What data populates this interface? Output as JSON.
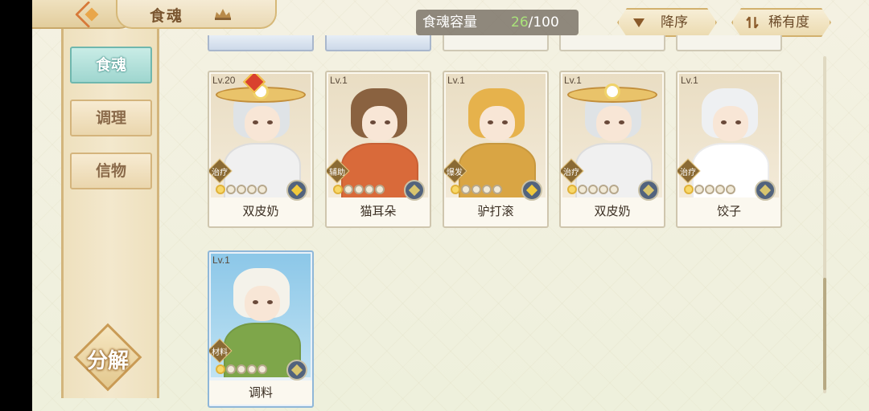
{
  "header": {
    "title": "食魂",
    "capacity_label": "食魂容量",
    "capacity_current": "26",
    "capacity_max": "/100",
    "sort_desc_label": "降序",
    "sort_rarity_label": "稀有度"
  },
  "sidebar": {
    "tabs": [
      {
        "label": "食魂",
        "active": true
      },
      {
        "label": "调理",
        "active": false
      },
      {
        "label": "信物",
        "active": false
      }
    ],
    "decompose_label": "分解"
  },
  "cards": [
    {
      "level": "Lv.20",
      "name": "双皮奶",
      "role": "治疗",
      "stars_on": 1,
      "stars_total": 5,
      "element": "gold-icon",
      "hair": "#dfe3e6",
      "body": "#f0f0f0",
      "hat": true,
      "badge": true,
      "style": "normal"
    },
    {
      "level": "Lv.1",
      "name": "猫耳朵",
      "role": "辅助",
      "stars_on": 1,
      "stars_total": 5,
      "element": "blue-icon",
      "hair": "#8a6240",
      "body": "#d96a3a",
      "hat": false,
      "badge": false,
      "style": "normal"
    },
    {
      "level": "Lv.1",
      "name": "驴打滚",
      "role": "爆发",
      "stars_on": 1,
      "stars_total": 5,
      "element": "gold-icon",
      "hair": "#e6b24c",
      "body": "#d9a544",
      "hat": false,
      "badge": false,
      "style": "normal"
    },
    {
      "level": "Lv.1",
      "name": "双皮奶",
      "role": "治疗",
      "stars_on": 1,
      "stars_total": 5,
      "element": "blue-icon",
      "hair": "#dfe3e6",
      "body": "#f0f0f0",
      "hat": true,
      "badge": false,
      "style": "normal"
    },
    {
      "level": "Lv.1",
      "name": "饺子",
      "role": "治疗",
      "stars_on": 1,
      "stars_total": 5,
      "element": "blue-icon",
      "hair": "#eef0f2",
      "body": "#ffffff",
      "hat": false,
      "badge": false,
      "style": "normal"
    },
    {
      "level": "Lv.1",
      "name": "调料",
      "role": "材料",
      "stars_on": 1,
      "stars_total": 5,
      "element": "blue-icon",
      "hair": "#f4f2ea",
      "body": "#7ea64a",
      "hat": false,
      "badge": false,
      "style": "blue"
    }
  ]
}
